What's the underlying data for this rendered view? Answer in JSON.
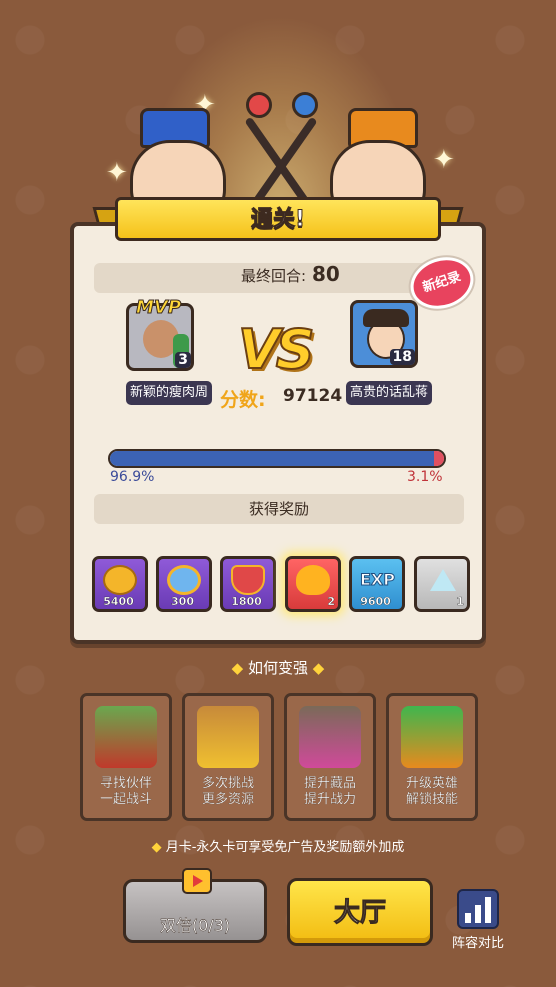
{
  "banner": {
    "title": "通关!"
  },
  "stats": {
    "round_label": "最终回合:",
    "round_value": "80",
    "new_record": "新纪录",
    "vs": "VS",
    "score_label": "分数:",
    "score_value": "97124"
  },
  "left_player": {
    "name": "新颖的瘦肉周",
    "level": "3",
    "tag": "MVP"
  },
  "right_player": {
    "name": "高贵的话乱蒋",
    "level": "18"
  },
  "progress": {
    "left_pct_text": "96.9%",
    "right_pct_text": "3.1%",
    "left_fraction": 0.969,
    "right_fraction": 0.031
  },
  "rewards": {
    "title": "获得奖励",
    "items": [
      {
        "icon": "coin-icon",
        "count": "5400",
        "style": "purple"
      },
      {
        "icon": "smile-medal-icon",
        "count": "300",
        "style": "purple"
      },
      {
        "icon": "shield-token-icon",
        "count": "1800",
        "style": "purple"
      },
      {
        "icon": "flame-icon",
        "count": "2",
        "style": "red"
      },
      {
        "icon": "exp-icon",
        "count": "9600",
        "style": "blue",
        "label": "EXP"
      },
      {
        "icon": "crystal-icon",
        "count": "1",
        "style": "gray"
      }
    ]
  },
  "how_to_improve": {
    "title": "如何变强",
    "tips": [
      {
        "text": "寻找伙伴\n一起战斗",
        "icon": "partners-icon"
      },
      {
        "text": "多次挑战\n更多资源",
        "icon": "treasure-chest-icon"
      },
      {
        "text": "提升藏品\n提升战力",
        "icon": "gauntlet-icon"
      },
      {
        "text": "升级英雄\n解锁技能",
        "icon": "hero-upgrade-icon"
      }
    ]
  },
  "month_tip": "月卡-永久卡可享受免广告及奖励额外加成",
  "buttons": {
    "double": "双倍(0/3)",
    "hall": "大厅",
    "compare": "阵容对比"
  },
  "colors": {
    "background": "#8a5a3c",
    "banner": "#f5c21a",
    "bar_blue": "#3c63b4",
    "bar_red": "#e05060",
    "new_record": "#e8435e",
    "score_label": "#f0a51a"
  }
}
